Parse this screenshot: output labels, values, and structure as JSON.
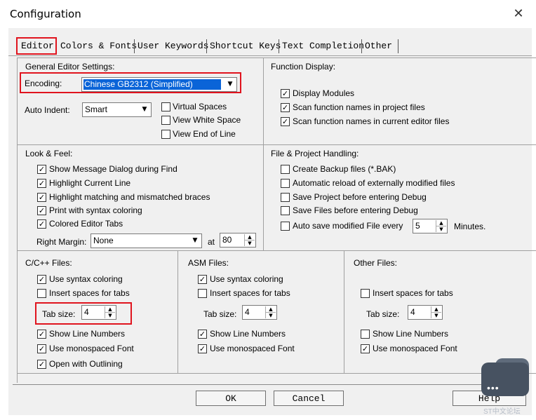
{
  "window": {
    "title": "Configuration",
    "close_symbol": "✕"
  },
  "tabs": [
    "Editor",
    "Colors & Fonts",
    "User Keywords",
    "Shortcut Keys",
    "Text Completion",
    "Other"
  ],
  "general": {
    "header": "General Editor Settings:",
    "encoding_label": "Encoding:",
    "encoding_value": "Chinese GB2312 (Simplified)",
    "auto_indent_label": "Auto Indent:",
    "auto_indent_value": "Smart",
    "virtual_spaces": "Virtual Spaces",
    "view_white_space": "View White Space",
    "view_end_of_line": "View End of Line"
  },
  "function_display": {
    "header": "Function Display:",
    "display_modules": "Display Modules",
    "scan_project": "Scan function names in project files",
    "scan_editor": "Scan function names in current editor files"
  },
  "look_feel": {
    "header": "Look & Feel:",
    "show_message": "Show Message Dialog during Find",
    "highlight_line": "Highlight Current Line",
    "highlight_braces": "Highlight matching and mismatched braces",
    "print_syntax": "Print with syntax coloring",
    "colored_tabs": "Colored Editor Tabs",
    "right_margin_label": "Right Margin:",
    "right_margin_value": "None",
    "at_label": "at",
    "at_value": "80"
  },
  "file_handling": {
    "header": "File & Project Handling:",
    "create_backup": "Create Backup files (*.BAK)",
    "auto_reload": "Automatic reload of externally modified files",
    "save_project": "Save Project before entering Debug",
    "save_files": "Save Files before entering Debug",
    "auto_save": "Auto save modified File every",
    "auto_save_value": "5",
    "minutes": "Minutes."
  },
  "c_files": {
    "header": "C/C++ Files:",
    "syntax": "Use syntax coloring",
    "insert_spaces": "Insert spaces for tabs",
    "tab_size_label": "Tab size:",
    "tab_size_value": "4",
    "line_numbers": "Show Line Numbers",
    "mono_font": "Use monospaced Font",
    "outlining": "Open with Outlining"
  },
  "asm_files": {
    "header": "ASM Files:",
    "syntax": "Use syntax coloring",
    "insert_spaces": "Insert spaces for tabs",
    "tab_size_label": "Tab size:",
    "tab_size_value": "4",
    "line_numbers": "Show Line Numbers",
    "mono_font": "Use monospaced Font"
  },
  "other_files": {
    "header": "Other Files:",
    "insert_spaces": "Insert spaces for tabs",
    "tab_size_label": "Tab size:",
    "tab_size_value": "4",
    "line_numbers": "Show Line Numbers",
    "mono_font": "Use monospaced Font"
  },
  "buttons": {
    "ok": "OK",
    "cancel": "Cancel",
    "help": "Help"
  },
  "check": "✓",
  "watermark": "ST中文论坛",
  "watermark_dots": "•••",
  "colors": {
    "highlight_red": "#e0141e",
    "selection_blue": "#0a64d8",
    "dialog_bg": "#f0f0f0"
  }
}
